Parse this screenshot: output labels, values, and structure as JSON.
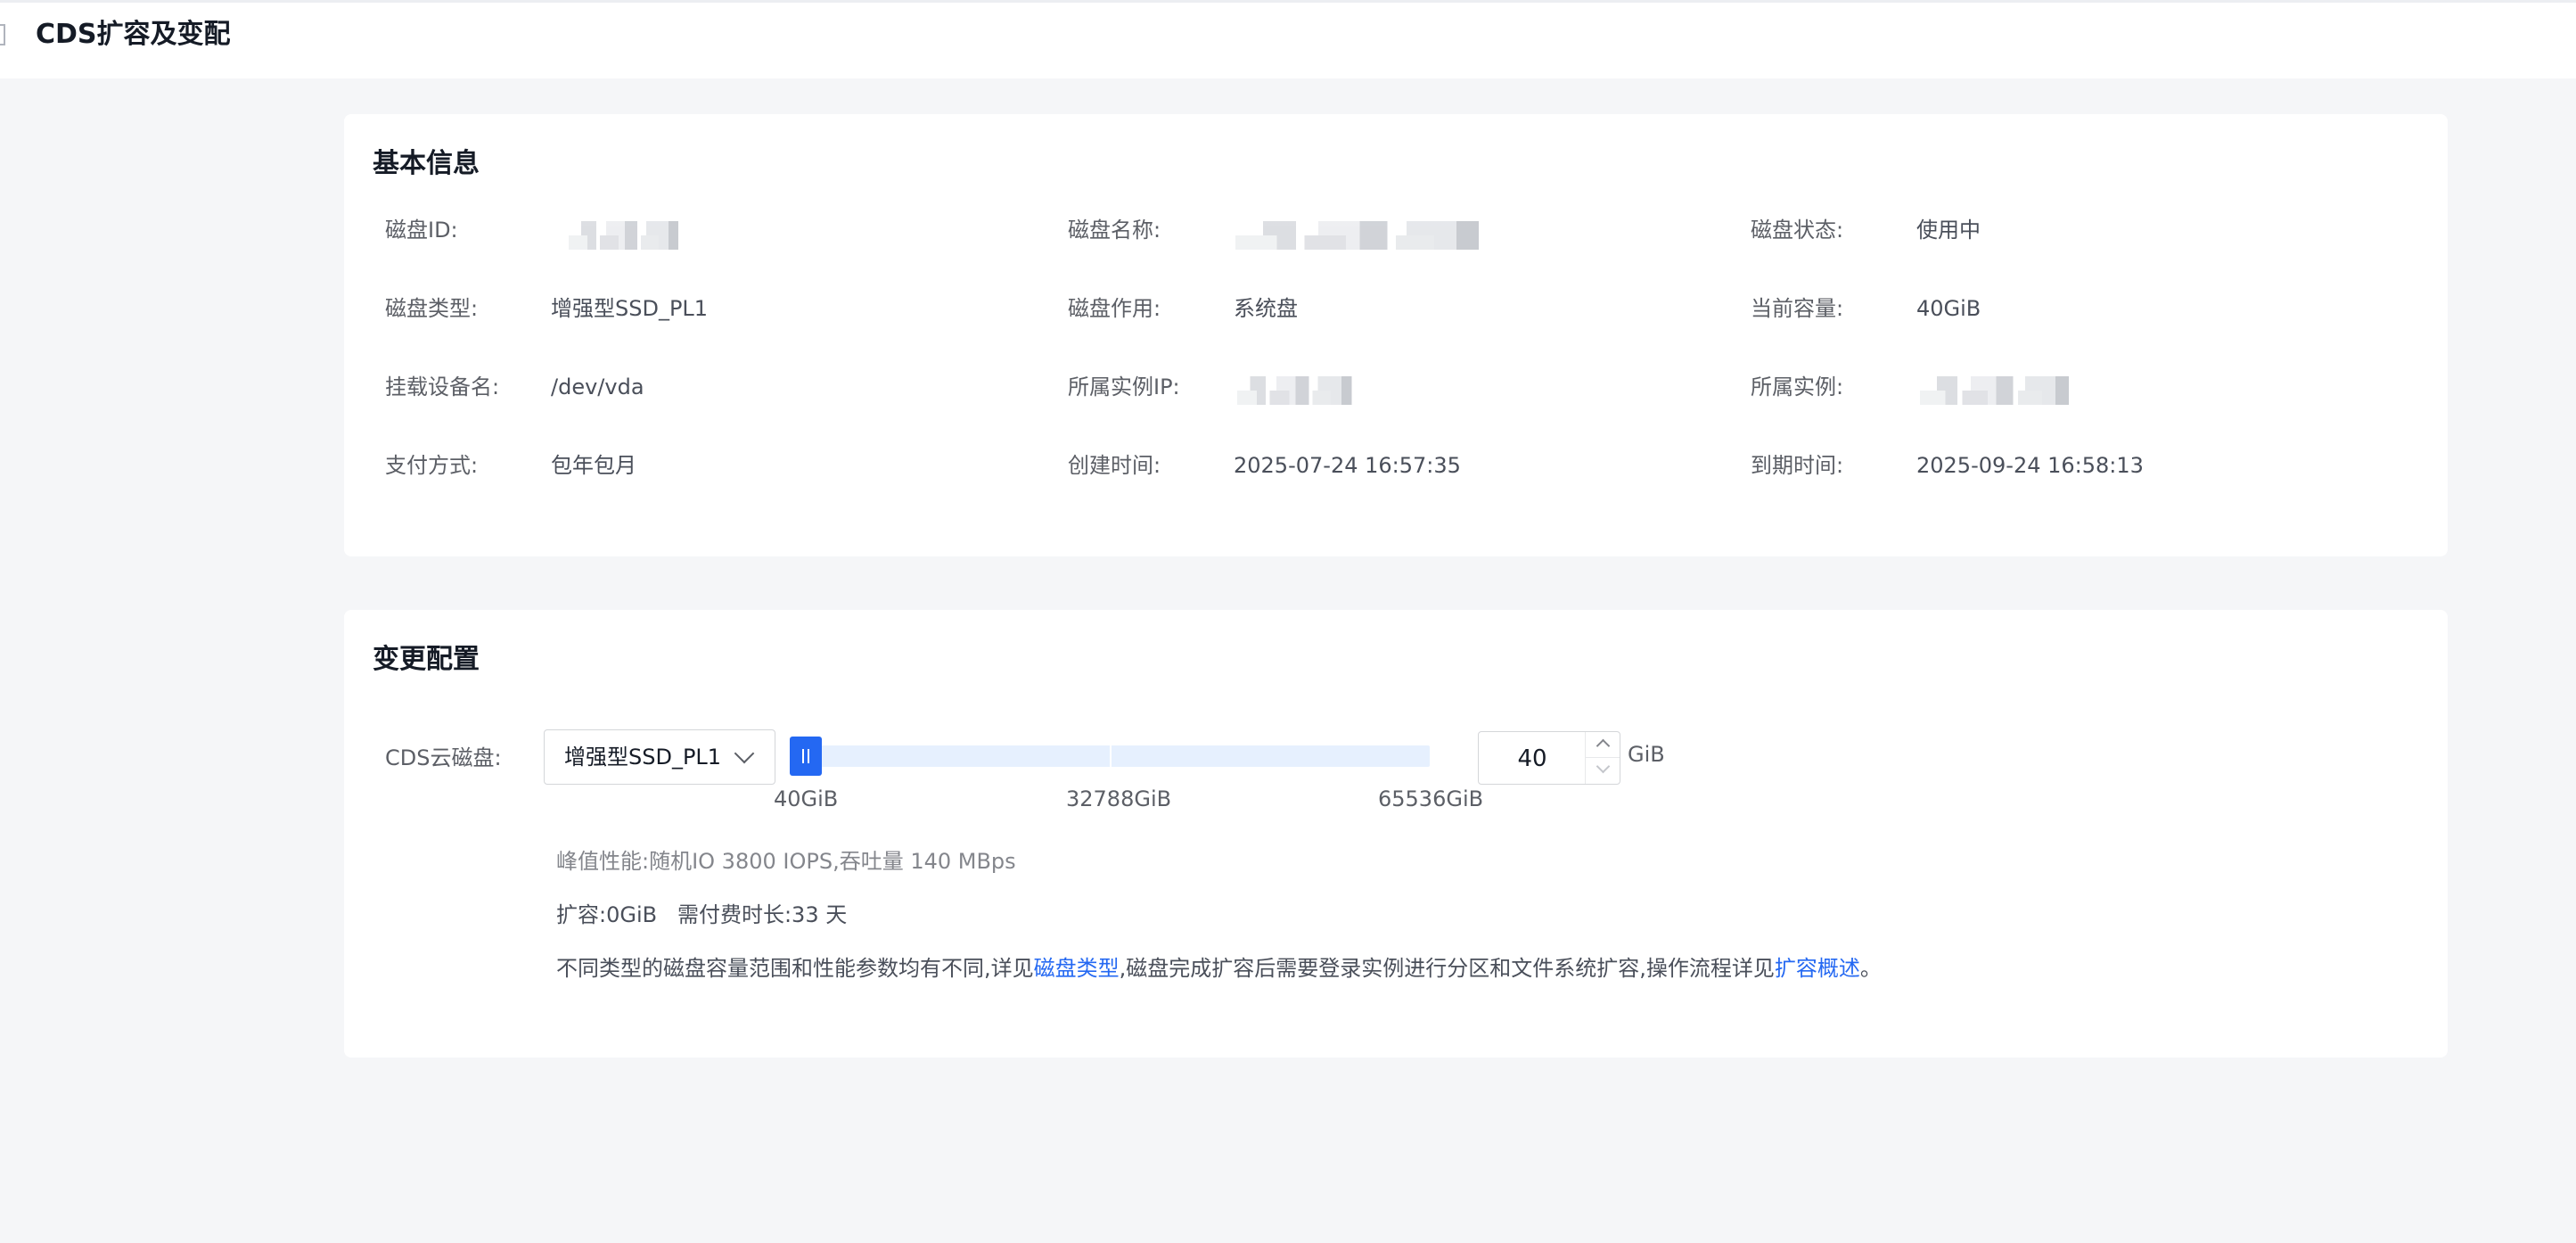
{
  "header": {
    "title": "CDS扩容及变配"
  },
  "basic_info": {
    "title": "基本信息",
    "fields": [
      {
        "label": "磁盘ID:",
        "value": ""
      },
      {
        "label": "磁盘名称:",
        "value": ""
      },
      {
        "label": "磁盘状态:",
        "value": "使用中"
      },
      {
        "label": "磁盘类型:",
        "value": "增强型SSD_PL1"
      },
      {
        "label": "磁盘作用:",
        "value": "系统盘"
      },
      {
        "label": "当前容量:",
        "value": "40GiB"
      },
      {
        "label": "挂载设备名:",
        "value": "/dev/vda"
      },
      {
        "label": "所属实例IP:",
        "value": ""
      },
      {
        "label": "所属实例:",
        "value": ""
      },
      {
        "label": "支付方式:",
        "value": "包年包月"
      },
      {
        "label": "创建时间:",
        "value": "2025-07-24 16:57:35"
      },
      {
        "label": "到期时间:",
        "value": "2025-09-24 16:58:13"
      }
    ]
  },
  "config": {
    "title": "变更配置",
    "disk_label": "CDS云磁盘:",
    "disk_type_selected": "增强型SSD_PL1",
    "slider": {
      "min_label": "40GiB",
      "mid_label": "32788GiB",
      "max_label": "65536GiB",
      "value_fraction": 0.0
    },
    "capacity_value": "40",
    "unit": "GiB",
    "performance": "峰值性能:随机IO 3800 IOPS,吞吐量 140 MBps",
    "expand": "扩容:0GiB   需付费时长:33 天",
    "note_prefix": "不同类型的磁盘容量范围和性能参数均有不同,详见",
    "note_link1": "磁盘类型",
    "note_middle": ",磁盘完成扩容后需要登录实例进行分区和文件系统扩容,操作流程详见",
    "note_link2": "扩容概述",
    "note_suffix": "。"
  },
  "colors": {
    "accent": "#2468f2",
    "slider_track": "#e6f0fe",
    "background": "#f5f6f8"
  }
}
